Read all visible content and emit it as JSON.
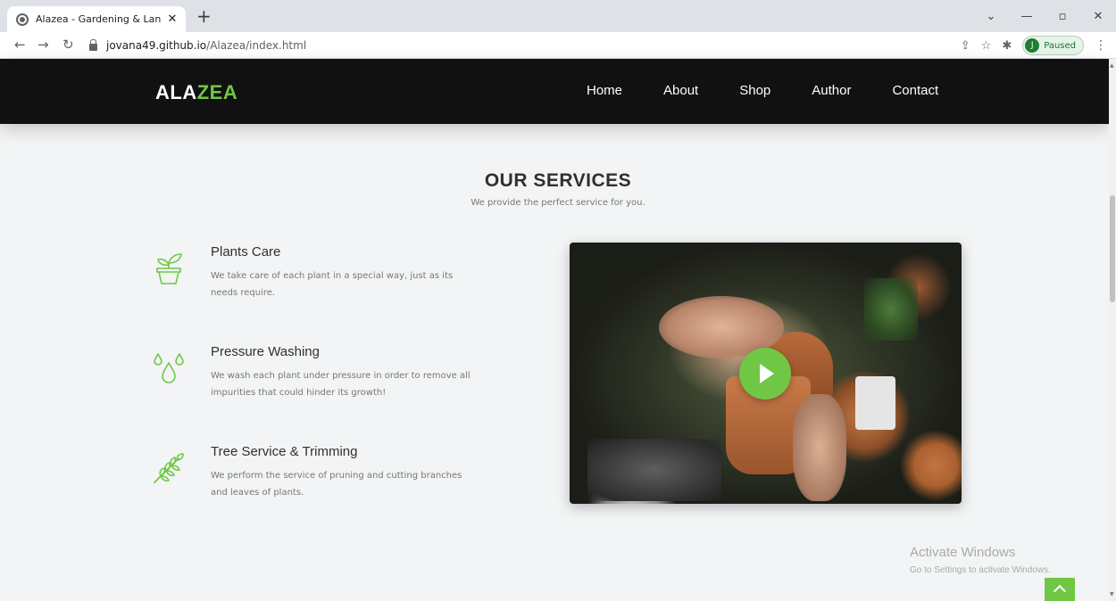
{
  "browser": {
    "tab_title": "Alazea - Gardening & Landscapi",
    "url_host": "jovana49.github.io",
    "url_path": "/Alazea/index.html",
    "profile_initial": "J",
    "profile_status": "Paused"
  },
  "header": {
    "logo_prefix": "ALA",
    "logo_accent": "ZEA",
    "nav": [
      "Home",
      "About",
      "Shop",
      "Author",
      "Contact"
    ]
  },
  "services": {
    "title": "OUR SERVICES",
    "subtitle": "We provide the perfect service for you.",
    "items": [
      {
        "title": "Plants Care",
        "description": "We take care of each plant in a special way, just as its needs require.",
        "icon": "potted-plant-icon"
      },
      {
        "title": "Pressure Washing",
        "description": "We wash each plant under pressure in order to remove all impurities that could hinder its growth!",
        "icon": "water-drops-icon"
      },
      {
        "title": "Tree Service & Trimming",
        "description": "We perform the service of pruning and cutting branches and leaves of plants.",
        "icon": "leaf-branch-icon"
      }
    ]
  },
  "watermark": {
    "line1": "Activate Windows",
    "line2": "Go to Settings to activate Windows."
  },
  "colors": {
    "accent": "#70c745",
    "header_bg": "#111111",
    "page_bg": "#f2f4f5"
  }
}
